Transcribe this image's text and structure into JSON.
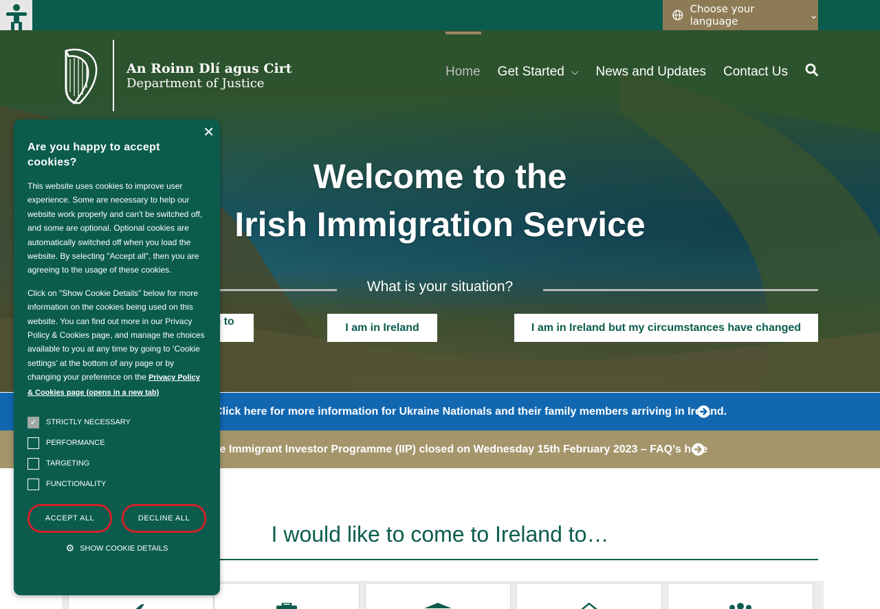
{
  "topbar": {
    "accessibility_icon": "accessibility-person-icon",
    "language": {
      "icon": "globe-icon",
      "label": "Choose your language",
      "chevron": "chevron-down-icon"
    }
  },
  "logo": {
    "irish": "An Roinn Dlí agus Cirt",
    "english": "Department of Justice"
  },
  "nav": {
    "items": [
      {
        "label": "Home"
      },
      {
        "label": "Get Started"
      },
      {
        "label": "News and Updates"
      },
      {
        "label": "Contact Us"
      }
    ]
  },
  "hero": {
    "title_line1": "Welcome to the",
    "title_line2": "Irish Immigration Service",
    "situation": "What is your situation?",
    "buttons": [
      "I want to come to Ireland",
      "I am in Ireland",
      "I am in Ireland but my circumstances have changed"
    ]
  },
  "banners": {
    "ukraine": "Click here for more information for Ukraine Nationals and their family members arriving in Ireland.",
    "iip": "The Immigrant Investor Programme (IIP) closed on Wednesday 15th February 2023 – FAQ’s here"
  },
  "section": {
    "title": "I would like to come to Ireland to…"
  },
  "cookie": {
    "title": "Are you happy to accept cookies?",
    "para1": "This website uses cookies to improve user experience. Some are necessary to help our website work properly and can't be switched off, and some are optional. Optional cookies are automatically switched off when you load the website. By selecting \"Accept all\", then you are agreeing to the usage of these cookies.",
    "para2": "Click on \"Show Cookie Details\" below for more information on the cookies being used on this website. You can find out more in our Privacy Policy & Cookies page, and manage the choices available to you at any time by going to ‘Cookie settings’ at the bottom of any page or by changing your preference on the",
    "link": "Privacy Policy & Cookies page (opens in a new tab)",
    "options": [
      {
        "label": "STRICTLY NECESSARY",
        "checked": true
      },
      {
        "label": "PERFORMANCE",
        "checked": false
      },
      {
        "label": "TARGETING",
        "checked": false
      },
      {
        "label": "FUNCTIONALITY",
        "checked": false
      }
    ],
    "accept": "ACCEPT ALL",
    "decline": "DECLINE ALL",
    "details": "SHOW COOKIE DETAILS"
  },
  "colors": {
    "brand_green": "#0b5c4d",
    "tan": "#a4956b",
    "blue": "#1167b0",
    "red": "#d3212a"
  }
}
